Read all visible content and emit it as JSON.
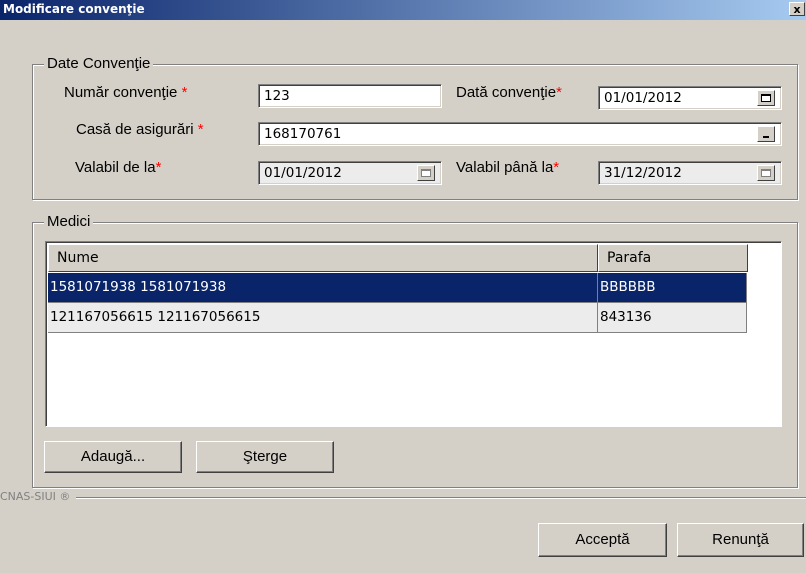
{
  "window": {
    "title": "Modificare convenţie",
    "close_label": "x"
  },
  "group_conventie": {
    "legend": "Date Convenţie",
    "numar_label": "Număr convenţie",
    "numar_value": "123",
    "data_label": "Dată convenţie",
    "data_value": "01/01/2012",
    "casa_label": "Casă de asigurări",
    "casa_value": "168170761",
    "valabil_de_la_label": "Valabil de la",
    "valabil_de_la_value": "01/01/2012",
    "valabil_pana_label": "Valabil până la",
    "valabil_pana_value": "31/12/2012",
    "required_mark": "*"
  },
  "group_medici": {
    "legend": "Medici",
    "columns": [
      "Nume",
      "Parafa"
    ],
    "rows": [
      {
        "nume": "1581071938 1581071938",
        "parafa": "BBBBBB",
        "selected": true
      },
      {
        "nume": "121167056615 121167056615",
        "parafa": "843136",
        "selected": false
      }
    ],
    "add_button": "Adaugă...",
    "delete_button": "Şterge"
  },
  "footer": {
    "brand": "CNAS-SIUI ®",
    "accept_button": "Acceptă",
    "cancel_button": "Renunţă"
  },
  "colors": {
    "title_bar": "#0a246a",
    "selection": "#0a246a",
    "required": "#ff0000",
    "window_bg": "#d4d0c8"
  }
}
